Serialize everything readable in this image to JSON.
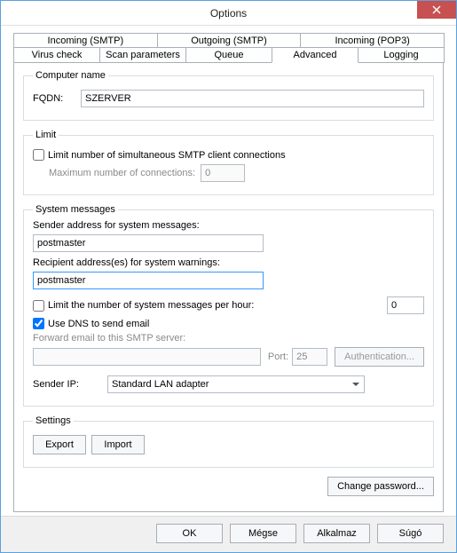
{
  "window": {
    "title": "Options"
  },
  "tabs": {
    "top": [
      {
        "label": "Incoming (SMTP)"
      },
      {
        "label": "Outgoing (SMTP)"
      },
      {
        "label": "Incoming (POP3)"
      }
    ],
    "bottom": [
      {
        "label": "Virus check"
      },
      {
        "label": "Scan parameters"
      },
      {
        "label": "Queue"
      },
      {
        "label": "Advanced"
      },
      {
        "label": "Logging"
      }
    ]
  },
  "computer_name": {
    "legend": "Computer name",
    "fqdn_label": "FQDN:",
    "fqdn_value": "SZERVER"
  },
  "limit": {
    "legend": "Limit",
    "checkbox_label": "Limit number of simultaneous SMTP client connections",
    "max_label": "Maximum number of connections:",
    "max_value": "0"
  },
  "system_messages": {
    "legend": "System messages",
    "sender_label": "Sender address for system messages:",
    "sender_value": "postmaster",
    "recipient_label": "Recipient address(es) for system warnings:",
    "recipient_value": "postmaster",
    "limit_hour_label": "Limit the number of system messages per hour:",
    "limit_hour_value": "0",
    "use_dns_label": "Use DNS to send email",
    "forward_label": "Forward email to this SMTP server:",
    "forward_value": "",
    "port_label": "Port:",
    "port_value": "25",
    "auth_button": "Authentication...",
    "sender_ip_label": "Sender IP:",
    "sender_ip_value": "Standard LAN adapter"
  },
  "settings": {
    "legend": "Settings",
    "export_button": "Export",
    "import_button": "Import"
  },
  "change_password_button": "Change password...",
  "buttons": {
    "ok": "OK",
    "cancel": "Mégse",
    "apply": "Alkalmaz",
    "help": "Súgó"
  }
}
